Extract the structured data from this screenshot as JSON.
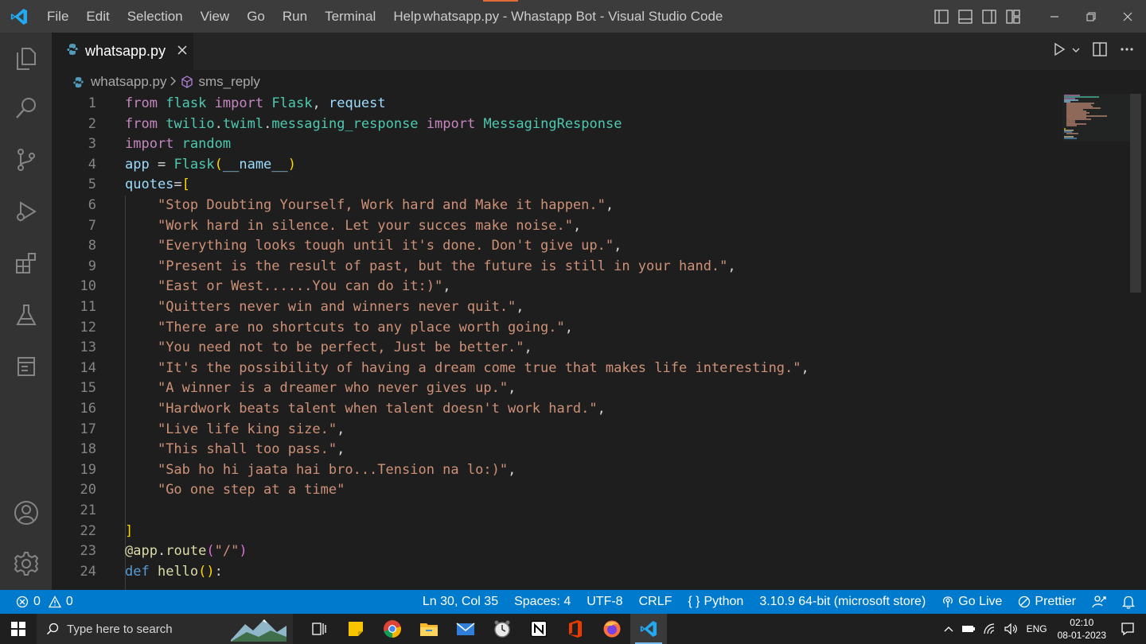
{
  "titlebar": {
    "menu": [
      "File",
      "Edit",
      "Selection",
      "View",
      "Go",
      "Run",
      "Terminal",
      "Help"
    ],
    "window_title": "whatsapp.py - Whastapp Bot - Visual Studio Code"
  },
  "tabs": [
    {
      "label": "whatsapp.py",
      "icon": "python-file-icon",
      "active": true
    }
  ],
  "breadcrumb": {
    "file": "whatsapp.py",
    "symbol": "sms_reply"
  },
  "editor": {
    "lines": [
      {
        "n": "1",
        "tokens": [
          [
            "kw",
            "from"
          ],
          [
            "plain",
            " "
          ],
          [
            "mod",
            "flask"
          ],
          [
            "plain",
            " "
          ],
          [
            "kw",
            "import"
          ],
          [
            "plain",
            " "
          ],
          [
            "mod",
            "Flask"
          ],
          [
            "plain",
            ", "
          ],
          [
            "var",
            "request"
          ]
        ]
      },
      {
        "n": "2",
        "tokens": [
          [
            "kw",
            "from"
          ],
          [
            "plain",
            " "
          ],
          [
            "mod",
            "twilio"
          ],
          [
            "plain",
            "."
          ],
          [
            "mod",
            "twiml"
          ],
          [
            "plain",
            "."
          ],
          [
            "mod",
            "messaging_response"
          ],
          [
            "plain",
            " "
          ],
          [
            "kw",
            "import"
          ],
          [
            "plain",
            " "
          ],
          [
            "mod",
            "MessagingResponse"
          ]
        ]
      },
      {
        "n": "3",
        "tokens": [
          [
            "kw",
            "import"
          ],
          [
            "plain",
            " "
          ],
          [
            "mod",
            "random"
          ]
        ]
      },
      {
        "n": "4",
        "tokens": [
          [
            "var",
            "app"
          ],
          [
            "plain",
            " = "
          ],
          [
            "mod",
            "Flask"
          ],
          [
            "brk",
            "("
          ],
          [
            "var",
            "__name__"
          ],
          [
            "brk",
            ")"
          ]
        ]
      },
      {
        "n": "5",
        "tokens": [
          [
            "var",
            "quotes"
          ],
          [
            "plain",
            "="
          ],
          [
            "brk",
            "["
          ]
        ]
      },
      {
        "n": "6",
        "tokens": [
          [
            "plain",
            "    "
          ],
          [
            "str",
            "\"Stop Doubting Yourself, Work hard and Make it happen.\""
          ],
          [
            "plain",
            ","
          ]
        ]
      },
      {
        "n": "7",
        "tokens": [
          [
            "plain",
            "    "
          ],
          [
            "str",
            "\"Work hard in silence. Let your succes make noise.\""
          ],
          [
            "plain",
            ","
          ]
        ]
      },
      {
        "n": "8",
        "tokens": [
          [
            "plain",
            "    "
          ],
          [
            "str",
            "\"Everything looks tough until it's done. Don't give up.\""
          ],
          [
            "plain",
            ","
          ]
        ]
      },
      {
        "n": "9",
        "tokens": [
          [
            "plain",
            "    "
          ],
          [
            "str",
            "\"Present is the result of past, but the future is still in your hand.\""
          ],
          [
            "plain",
            ","
          ]
        ]
      },
      {
        "n": "10",
        "tokens": [
          [
            "plain",
            "    "
          ],
          [
            "str",
            "\"East or West......You can do it:)\""
          ],
          [
            "plain",
            ","
          ]
        ]
      },
      {
        "n": "11",
        "tokens": [
          [
            "plain",
            "    "
          ],
          [
            "str",
            "\"Quitters never win and winners never quit.\""
          ],
          [
            "plain",
            ","
          ]
        ]
      },
      {
        "n": "12",
        "tokens": [
          [
            "plain",
            "    "
          ],
          [
            "str",
            "\"There are no shortcuts to any place worth going.\""
          ],
          [
            "plain",
            ","
          ]
        ]
      },
      {
        "n": "13",
        "tokens": [
          [
            "plain",
            "    "
          ],
          [
            "str",
            "\"You need not to be perfect, Just be better.\""
          ],
          [
            "plain",
            ","
          ]
        ]
      },
      {
        "n": "14",
        "tokens": [
          [
            "plain",
            "    "
          ],
          [
            "str",
            "\"It's the possibility of having a dream come true that makes life interesting.\""
          ],
          [
            "plain",
            ","
          ]
        ]
      },
      {
        "n": "15",
        "tokens": [
          [
            "plain",
            "    "
          ],
          [
            "str",
            "\"A winner is a dreamer who never gives up.\""
          ],
          [
            "plain",
            ","
          ]
        ]
      },
      {
        "n": "16",
        "tokens": [
          [
            "plain",
            "    "
          ],
          [
            "str",
            "\"Hardwork beats talent when talent doesn't work hard.\""
          ],
          [
            "plain",
            ","
          ]
        ]
      },
      {
        "n": "17",
        "tokens": [
          [
            "plain",
            "    "
          ],
          [
            "str",
            "\"Live life king size.\""
          ],
          [
            "plain",
            ","
          ]
        ]
      },
      {
        "n": "18",
        "tokens": [
          [
            "plain",
            "    "
          ],
          [
            "str",
            "\"This shall too pass.\""
          ],
          [
            "plain",
            ","
          ]
        ]
      },
      {
        "n": "19",
        "tokens": [
          [
            "plain",
            "    "
          ],
          [
            "str",
            "\"Sab ho hi jaata hai bro...Tension na lo:)\""
          ],
          [
            "plain",
            ","
          ]
        ]
      },
      {
        "n": "20",
        "tokens": [
          [
            "plain",
            "    "
          ],
          [
            "str",
            "\"Go one step at a time\""
          ]
        ]
      },
      {
        "n": "21",
        "tokens": []
      },
      {
        "n": "22",
        "tokens": [
          [
            "brk",
            "]"
          ]
        ]
      },
      {
        "n": "23",
        "tokens": [
          [
            "fn",
            "@app"
          ],
          [
            "plain",
            "."
          ],
          [
            "fn",
            "route"
          ],
          [
            "brk2",
            "("
          ],
          [
            "str",
            "\"/\""
          ],
          [
            "brk2",
            ")"
          ]
        ]
      },
      {
        "n": "24",
        "tokens": [
          [
            "kw2",
            "def"
          ],
          [
            "plain",
            " "
          ],
          [
            "fn",
            "hello"
          ],
          [
            "brk",
            "()"
          ],
          [
            "plain",
            ":"
          ]
        ]
      }
    ]
  },
  "statusbar": {
    "errors": "0",
    "warnings": "0",
    "position": "Ln 30, Col 35",
    "spaces": "Spaces: 4",
    "encoding": "UTF-8",
    "eol": "CRLF",
    "language": "Python",
    "interpreter": "3.10.9 64-bit (microsoft store)",
    "go_live": "Go Live",
    "prettier": "Prettier"
  },
  "taskbar": {
    "search_placeholder": "Type here to search",
    "language": "ENG",
    "time": "02:10",
    "date": "08-01-2023"
  },
  "colors": {
    "accent": "#007acc",
    "keyword": "#c586c0",
    "string": "#ce9178",
    "class": "#4ec9b0"
  }
}
